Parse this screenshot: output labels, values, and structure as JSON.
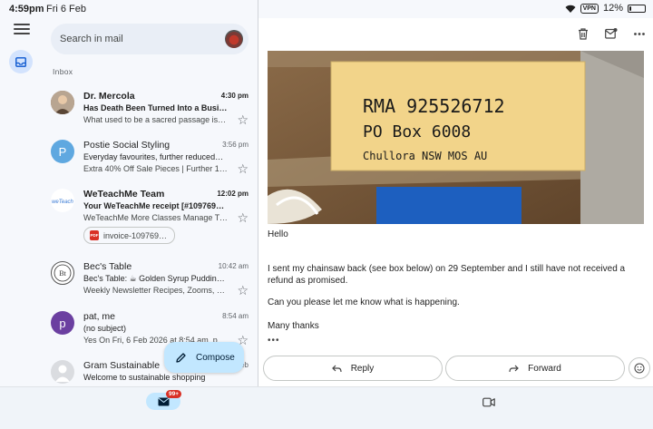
{
  "status_bar": {
    "time": "4:59pm",
    "date": "Fri 6 Feb",
    "vpn": "VPN",
    "battery": "12%",
    "battery_level": 0.12
  },
  "search": {
    "placeholder": "Search in mail"
  },
  "section_label": "Inbox",
  "emails": [
    {
      "sender": "Dr. Mercola",
      "time": "4:30 pm",
      "subject": "Has Death Been Turned Into a Busi…",
      "preview": "What used to be a sacred passage is…",
      "unread": true
    },
    {
      "sender": "Postie Social Styling",
      "avatar_letter": "P",
      "avatar_color": "#5fa8e0",
      "time": "3:56 pm",
      "subject": "Everyday favourites, further reduced…",
      "preview": "Extra 40% Off Sale Pieces | Further 1…",
      "unread": false
    },
    {
      "sender": "WeTeachMe Team",
      "time": "12:02 pm",
      "subject": "Your WeTeachMe receipt [#109769…",
      "preview": "WeTeachMe More Classes Manage Ti…",
      "attachment": "invoice-109769…",
      "unread": true
    },
    {
      "sender": "Bec's Table",
      "time": "10:42 am",
      "subject": "Bec's Table: ☕ Golden Syrup Puddin…",
      "preview": "Weekly Newsletter Recipes, Zooms, C…",
      "unread": false
    },
    {
      "sender": "pat, me",
      "avatar_letter": "p",
      "avatar_color": "#6b3fa0",
      "time": "8:54 am",
      "subject": "(no subject)",
      "preview": "Yes On Fri, 6 Feb 2026 at 8:54 am, pa…",
      "unread": false
    },
    {
      "sender": "Gram Sustainable",
      "time": "eb",
      "subject": "Welcome to sustainable shopping",
      "preview": "",
      "unread": false
    }
  ],
  "compose_label": "Compose",
  "message": {
    "image_lines": [
      "RMA  925526712",
      "PO Box  6008",
      "Chullora   NSW  MOS AU"
    ],
    "greeting": "Hello",
    "paragraph1": "I sent my chainsaw back (see box below) on 29 September and I still have not received a refund as promised.",
    "paragraph2": "Can you please let me know what is happening.",
    "signoff": "Many thanks",
    "more": "•••"
  },
  "actions": {
    "reply": "Reply",
    "forward": "Forward"
  },
  "bottom_nav": {
    "mail_badge": "99+"
  },
  "colors": {
    "accent": "#c2e7ff",
    "selected_rail": "#d3e3fd",
    "badge": "#d93025"
  }
}
